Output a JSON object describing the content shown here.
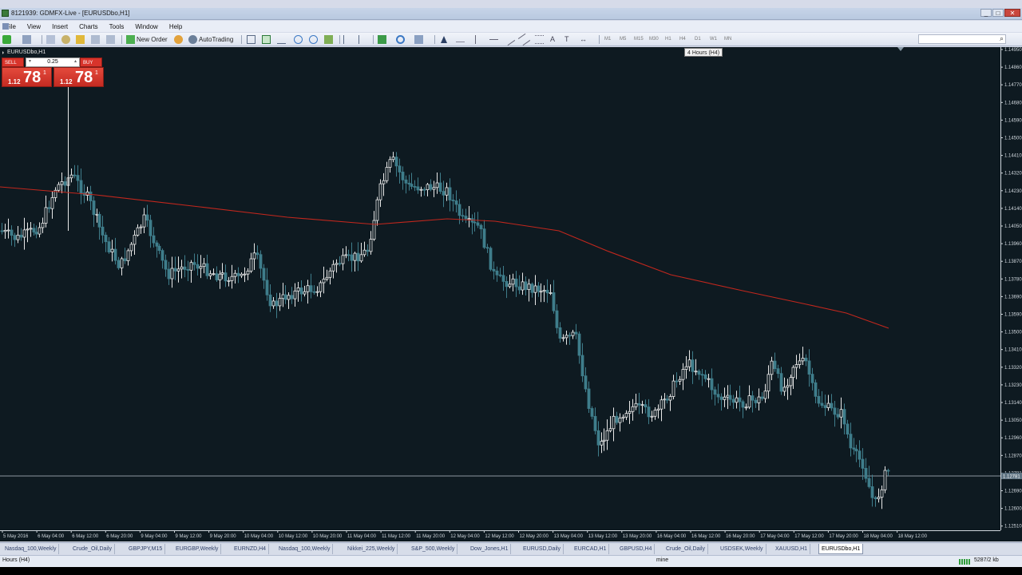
{
  "window": {
    "title": "8121939: GDMFX-Live - [EURUSDbo,H1]",
    "controls": [
      "_",
      "□",
      "✕"
    ]
  },
  "menu": [
    "File",
    "View",
    "Insert",
    "Charts",
    "Tools",
    "Window",
    "Help"
  ],
  "toolbar": {
    "new_order": "New Order",
    "autotrading": "AutoTrading",
    "timeframes": [
      "M1",
      "M5",
      "M15",
      "M30",
      "H1",
      "H4",
      "D1",
      "W1",
      "MN"
    ],
    "search_icon": "search-icon",
    "tooltip": "4 Hours (H4)"
  },
  "chart": {
    "symbol_label": "EURUSDbo,H1",
    "one_click": {
      "sell": "SELL",
      "buy": "BUY",
      "lot": "0.25",
      "sell_prefix": "1.12",
      "sell_big": "78",
      "sell_sup": "1",
      "buy_prefix": "1.12",
      "buy_big": "78",
      "buy_sup": "1",
      "color": "#d8342b"
    },
    "colors": {
      "background": "#0e1a21",
      "bull": "#e8e8e8",
      "bear": "#3f7d8b",
      "ma": "#c2271d",
      "grid_text": "#cfd6dc",
      "bid_label": "#5e7382"
    },
    "price_labels": [
      "1.14950",
      "1.14860",
      "1.14770",
      "1.14680",
      "1.14590",
      "1.14500",
      "1.14410",
      "1.14320",
      "1.14230",
      "1.14140",
      "1.14050",
      "1.13960",
      "1.13870",
      "1.13780",
      "1.13690",
      "1.13590",
      "1.13500",
      "1.13410",
      "1.13320",
      "1.13230",
      "1.13140",
      "1.13050",
      "1.12960",
      "1.12870",
      "1.12781",
      "1.12690",
      "1.12600",
      "1.12510"
    ],
    "bid_price": "1.12781",
    "time_labels": [
      "5 May 2016",
      "6 May 04:00",
      "6 May 12:00",
      "6 May 20:00",
      "9 May 04:00",
      "9 May 12:00",
      "9 May 20:00",
      "10 May 04:00",
      "10 May 12:00",
      "10 May 20:00",
      "11 May 04:00",
      "11 May 12:00",
      "11 May 20:00",
      "12 May 04:00",
      "12 May 12:00",
      "12 May 20:00",
      "13 May 04:00",
      "13 May 12:00",
      "13 May 20:00",
      "16 May 04:00",
      "16 May 12:00",
      "16 May 20:00",
      "17 May 04:00",
      "17 May 12:00",
      "17 May 20:00",
      "18 May 04:00",
      "18 May 12:00"
    ]
  },
  "tabs": [
    "Nasdaq_100,Weekly",
    "Crude_Oil,Daily",
    "GBPJPY,M15",
    "EURGBP,Weekly",
    "EURNZD,H4",
    "Nasdaq_100,Weekly",
    "Nikkei_225,Weekly",
    "S&P_500,Weekly",
    "Dow_Jones,H1",
    "EURUSD,Daily",
    "EURCAD,H1",
    "GBPUSD,H4",
    "Crude_Oil,Daily",
    "USDSEK,Weekly",
    "XAUUSD,H1",
    "EURUSDbo,H1"
  ],
  "active_tab": "EURUSDbo,H1",
  "status": {
    "left": "Hours (H4)",
    "middle": "mine",
    "right": "5287/2 kb"
  }
}
